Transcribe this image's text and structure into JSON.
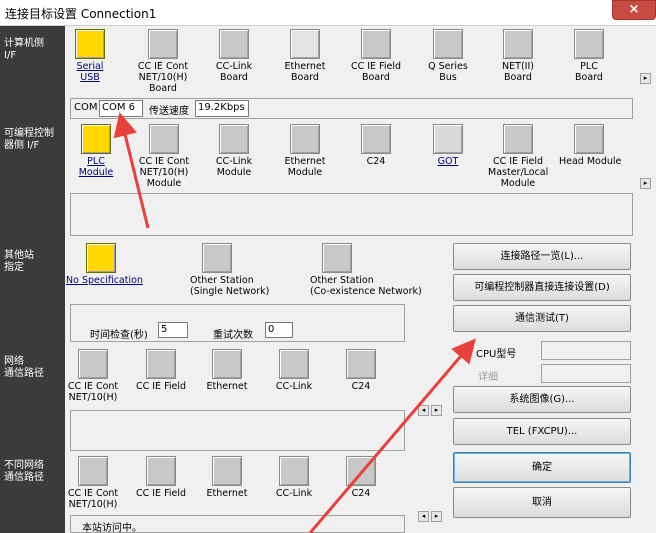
{
  "window": {
    "title": "连接目标设置 Connection1",
    "close_glyph": "×"
  },
  "sections": {
    "pc_side": "计算机侧\nI/F",
    "plc_side": "可编程控制\n器侧 I/F",
    "other_station": "其他站\n指定",
    "network_route": "网络\n通信路径",
    "diff_network_route": "不同网络\n通信路径"
  },
  "pc_if": [
    {
      "label": "Serial\nUSB",
      "selected": true
    },
    {
      "label": "CC IE Cont\nNET/10(H)\nBoard"
    },
    {
      "label": "CC-Link\nBoard"
    },
    {
      "label": "Ethernet\nBoard"
    },
    {
      "label": "CC IE Field\nBoard"
    },
    {
      "label": "Q Series\nBus"
    },
    {
      "label": "NET(II)\nBoard"
    },
    {
      "label": "PLC\nBoard"
    }
  ],
  "com": {
    "label": "COM",
    "port": "COM 6",
    "speed_label": "传送速度",
    "speed": "19.2Kbps"
  },
  "plc_if": [
    {
      "label": "PLC\nModule",
      "selected": true
    },
    {
      "label": "CC IE Cont\nNET/10(H)\nModule"
    },
    {
      "label": "CC-Link\nModule"
    },
    {
      "label": "Ethernet\nModule"
    },
    {
      "label": "C24"
    },
    {
      "label": "GOT"
    },
    {
      "label": "CC IE Field\nMaster/Local\nModule"
    },
    {
      "label": "Head Module"
    }
  ],
  "other": [
    {
      "label": "No Specification",
      "selected": true
    },
    {
      "label": "Other Station\n(Single Network)"
    },
    {
      "label": "Other Station\n(Co-existence Network)"
    }
  ],
  "timing": {
    "check_label": "时间检查(秒)",
    "check_value": "5",
    "retry_label": "重试次数",
    "retry_value": "0"
  },
  "network": [
    "CC IE Cont\nNET/10(H)",
    "CC IE Field",
    "Ethernet",
    "CC-Link",
    "C24"
  ],
  "diff_network": [
    "CC IE Cont\nNET/10(H)",
    "CC IE Field",
    "Ethernet",
    "CC-Link",
    "C24"
  ],
  "status_text": "本站访问中。",
  "buttons": {
    "route_list": "连接路径一览(L)...",
    "direct_connect": "可编程控制器直接连接设置(D)",
    "comm_test": "通信测试(T)",
    "cpu_type": "CPU型号",
    "detail": "详细",
    "system_image": "系统图像(G)...",
    "tel": "TEL (FXCPU)...",
    "ok": "确定",
    "cancel": "取消"
  },
  "colors": {
    "sidebar": "#3b3b3b",
    "arrow": "#e8403a",
    "selected_icon": "#ffd800"
  }
}
